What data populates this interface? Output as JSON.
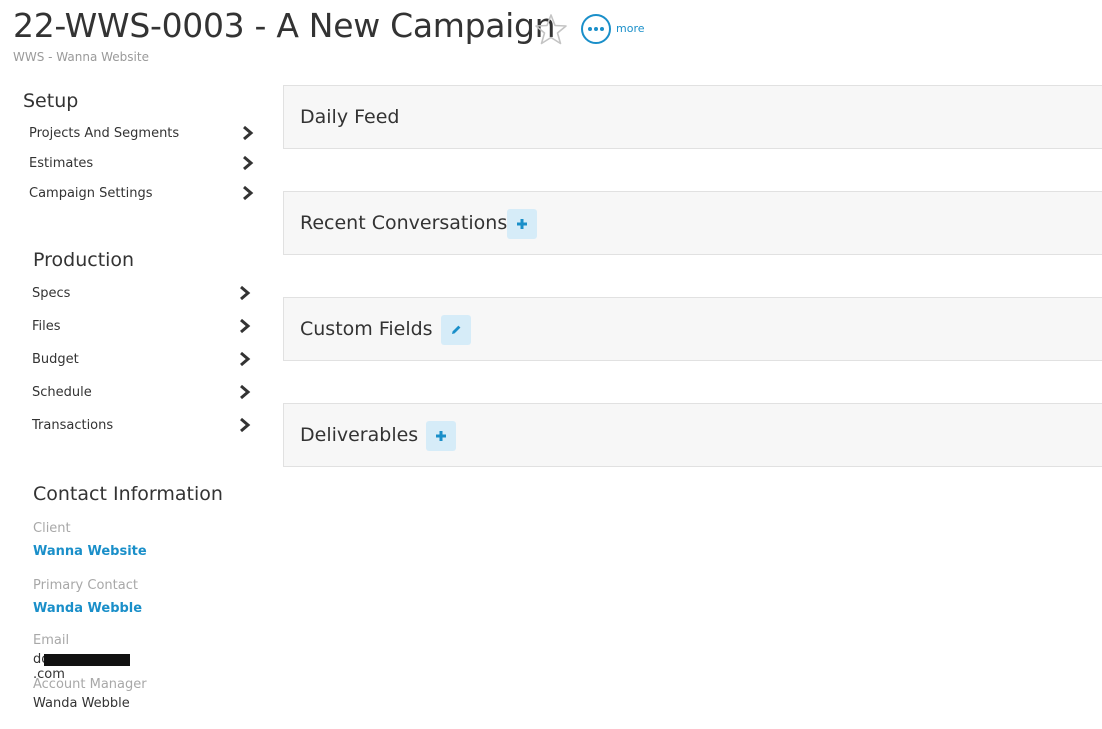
{
  "header": {
    "title": "22-WWS-0003 - A New Campaign",
    "subtitle": "WWS - Wanna Website",
    "more_label": "more"
  },
  "sidebar": {
    "setup": {
      "heading": "Setup",
      "items": [
        {
          "label": "Projects And Segments"
        },
        {
          "label": "Estimates"
        },
        {
          "label": "Campaign Settings"
        }
      ]
    },
    "production": {
      "heading": "Production",
      "items": [
        {
          "label": "Specs"
        },
        {
          "label": "Files"
        },
        {
          "label": "Budget"
        },
        {
          "label": "Schedule"
        },
        {
          "label": "Transactions"
        }
      ]
    },
    "contact": {
      "heading": "Contact Information",
      "client_label": "Client",
      "client_value": "Wanna Website",
      "primary_contact_label": "Primary Contact",
      "primary_contact_value": "Wanda Webble",
      "email_label": "Email",
      "email_value_start": "do",
      "email_value_end": ".com",
      "account_manager_label": "Account Manager",
      "account_manager_value": "Wanda Webble"
    }
  },
  "panels": [
    {
      "title": "Daily Feed",
      "action": null
    },
    {
      "title": "Recent Conversations",
      "action": "plus-icon"
    },
    {
      "title": "Custom Fields",
      "action": "pencil-icon"
    },
    {
      "title": "Deliverables",
      "action": "plus-icon"
    }
  ],
  "colors": {
    "accent": "#1a8fc9",
    "panel_bg": "#f7f7f7",
    "button_bg": "#d6ecf8",
    "muted_text": "#a8a8a8"
  }
}
